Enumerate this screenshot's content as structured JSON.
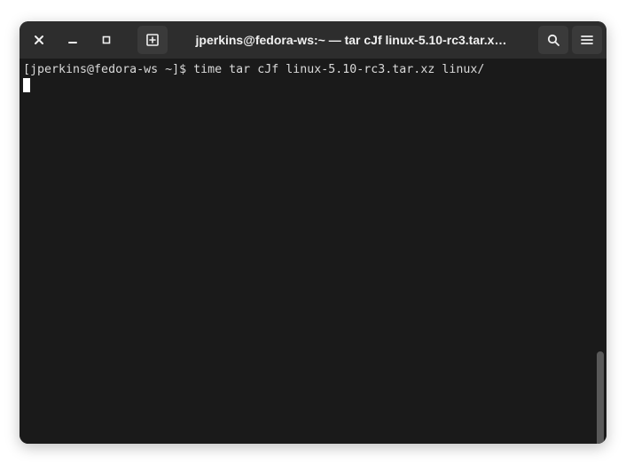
{
  "titlebar": {
    "title": "jperkins@fedora-ws:~ — tar cJf linux-5.10-rc3.tar.x…"
  },
  "terminal": {
    "prompt": "[jperkins@fedora-ws ~]$ ",
    "command": "time tar cJf linux-5.10-rc3.tar.xz linux/"
  }
}
